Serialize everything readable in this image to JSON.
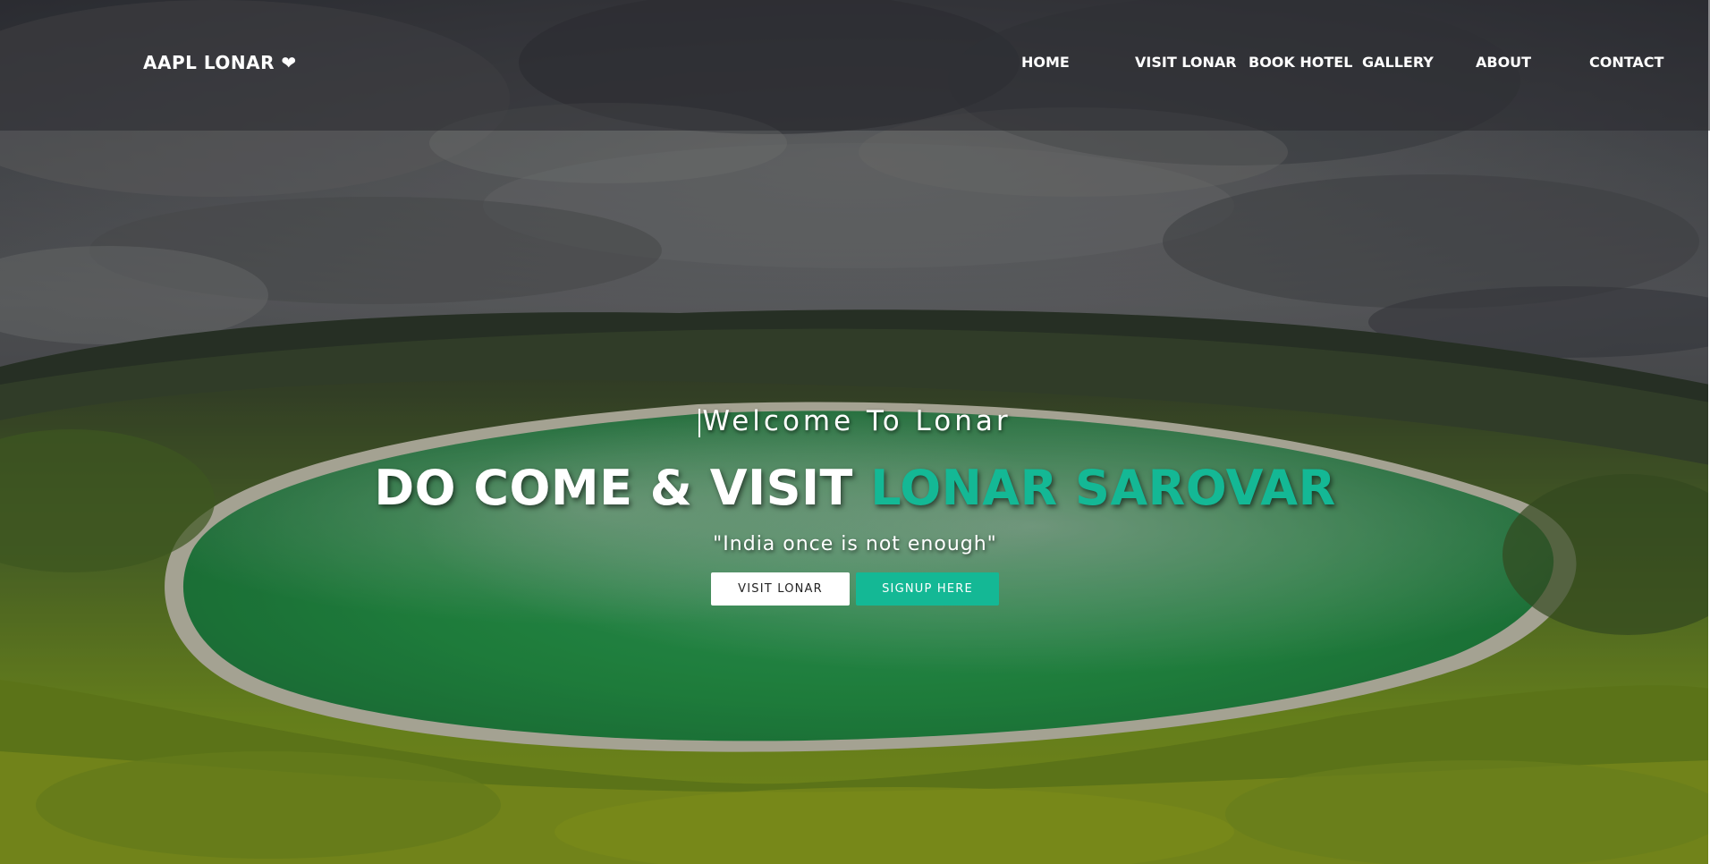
{
  "colors": {
    "accent": "#14b895",
    "nav_overlay": "#28282e",
    "text": "#ffffff"
  },
  "navbar": {
    "brand": "AAPL LONAR ❤",
    "links": [
      "HOME",
      "VISIT LONAR",
      "BOOK HOTEL",
      "GALLERY",
      "ABOUT",
      "CONTACT"
    ]
  },
  "hero": {
    "welcome": "Welcome To Lonar",
    "headline_prefix": "DO COME & VISIT ",
    "headline_accent": "LONAR SAROVAR",
    "tagline": "\"India once is not enough\"",
    "buttons": {
      "visit_label": "VISIT LONAR",
      "signup_label": "SIGNUP HERE"
    }
  }
}
